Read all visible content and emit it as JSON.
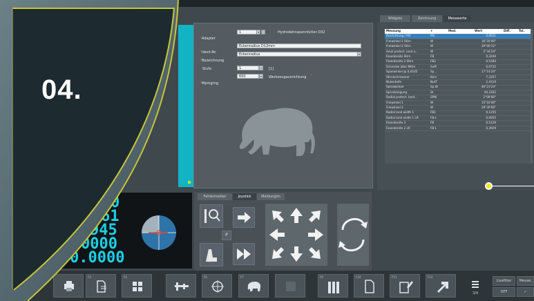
{
  "step": {
    "label": "04."
  },
  "form": {
    "adapter_label": "Adapter",
    "adapter_value": "1",
    "adapter_desc": "Hydrodehnspannfutter D32",
    "ident_label": "Ident-Nr.",
    "ident_value": "Eckenradius D12mm",
    "bezeichnung_label": "Bezeichnung",
    "bezeichnung_value": "Eckenradius",
    "stufe_label": "Stufe",
    "stufe_value": "1",
    "stufe_unit": "[1]",
    "mprogrrg_label": "Mprogrng.",
    "mprogrrg_value": "650",
    "werkzeug_label": "Werkzeugausrichtung"
  },
  "meas": {
    "tabs": [
      "Widgets",
      "Zeichnung",
      "Messwerte"
    ],
    "columns": [
      "Messung",
      "+",
      "Mod.",
      "Wert",
      "Diff.",
      "Tol."
    ],
    "rows": [
      {
        "name": "Ausrichtung / MV",
        "mod": "MV",
        "val": "0,0621"
      },
      {
        "name": "Freiwinkel 1 Stirn",
        "mod": "W",
        "val": "16°20'00\""
      },
      {
        "name": "Freiwinkel 2 Stirn",
        "mod": "W",
        "val": "29°46'12\""
      },
      {
        "name": "Axial protect. land a...",
        "mod": "W",
        "val": "5°34'24\""
      },
      {
        "name": "Fasenbreite Stirn",
        "mod": "FB",
        "val": "0,3244"
      },
      {
        "name": "Fasenbreite 2 Stirn",
        "mod": "FB2",
        "val": "0,5182"
      },
      {
        "name": "Schneide über Mitte",
        "mod": "SvM",
        "val": "0,0732"
      },
      {
        "name": "Spanwinkel @ 0,4105",
        "mod": "Sp...",
        "val": "17°14'24\""
      },
      {
        "name": "Stirnlochmesser",
        "mod": "Kern",
        "val": "7,3357"
      },
      {
        "name": "Nutentiefe",
        "mod": "NutT",
        "val": "2,4110"
      },
      {
        "name": "Spiralwinkel",
        "mod": "Sp.W",
        "val": "40°23'24\""
      },
      {
        "name": "Spiralsteigung",
        "mod": "St",
        "val": "44,3162"
      },
      {
        "name": "Radial protect. land...",
        "mod": "SPW",
        "val": "1°09'00\""
      },
      {
        "name": "Freiwinkel 1",
        "mod": "W",
        "val": "15°10'40\""
      },
      {
        "name": "Freiwinkel 2",
        "mod": "W",
        "val": "29°39'00\""
      },
      {
        "name": "Radial land width 1",
        "mod": "FB1",
        "val": "0,1255"
      },
      {
        "name": "Radial land width 1 LR",
        "mod": "FB-L",
        "val": "0,0955"
      },
      {
        "name": "Fasenbreite 2",
        "mod": "FB",
        "val": "0,5129"
      },
      {
        "name": "Fasenbreite 2 LR",
        "mod": "FB-L",
        "val": "0,3929"
      }
    ]
  },
  "bottom_tabs": [
    "Fehlermelder",
    "Joystick",
    "Meldungen"
  ],
  "display": {
    "v1": "0",
    "v2": "61",
    "v3": "945",
    "v4": "0000",
    "v5": "0.0000"
  },
  "toolbar": {
    "fkeys": [
      "F1",
      "F2",
      "F3",
      "F4",
      "F5",
      "F6",
      "F7",
      "F8",
      "F9",
      "F10",
      "F11",
      "F12"
    ],
    "page": "3/4",
    "livefilter": "Livefilter",
    "mess": "Messw.",
    "off": "OFF"
  }
}
